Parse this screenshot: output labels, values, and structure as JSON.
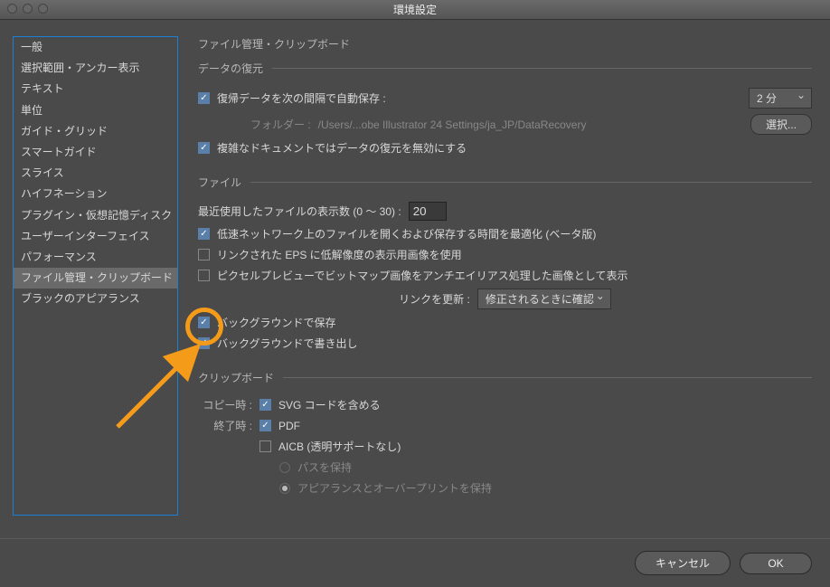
{
  "title": "環境設定",
  "sidebar": {
    "items": [
      "一般",
      "選択範囲・アンカー表示",
      "テキスト",
      "単位",
      "ガイド・グリッド",
      "スマートガイド",
      "スライス",
      "ハイフネーション",
      "プラグイン・仮想記憶ディスク",
      "ユーザーインターフェイス",
      "パフォーマンス",
      "ファイル管理・クリップボード",
      "ブラックのアピアランス"
    ],
    "selected_index": 11
  },
  "main": {
    "heading": "ファイル管理・クリップボード",
    "recovery": {
      "legend": "データの復元",
      "auto_save": {
        "checked": true,
        "label": "復帰データを次の間隔で自動保存 :"
      },
      "interval_value": "2 分",
      "folder_label": "フォルダー :",
      "folder_path": "/Users/...obe Illustrator 24 Settings/ja_JP/DataRecovery",
      "choose_button": "選択...",
      "disable_complex": {
        "checked": true,
        "label": "複雑なドキュメントではデータの復元を無効にする"
      }
    },
    "files": {
      "legend": "ファイル",
      "recent_label": "最近使用したファイルの表示数 (0 ～ 30)  :",
      "recent_value": "20",
      "slow_network": {
        "checked": true,
        "label": "低速ネットワーク上のファイルを開くおよび保存する時間を最適化 (ベータ版)"
      },
      "eps_lowres": {
        "checked": false,
        "label": "リンクされた EPS に低解像度の表示用画像を使用"
      },
      "pixel_preview": {
        "checked": false,
        "label": "ピクセルプレビューでビットマップ画像をアンチエイリアス処理した画像として表示"
      },
      "update_links_label": "リンクを更新 :",
      "update_links_value": "修正されるときに確認",
      "bg_save": {
        "checked": true,
        "label": "バックグラウンドで保存"
      },
      "bg_export": {
        "checked": true,
        "label": "バックグラウンドで書き出し"
      }
    },
    "clipboard": {
      "legend": "クリップボード",
      "copy_label": "コピー時 :",
      "quit_label": "終了時 :",
      "svg": {
        "checked": true,
        "label": "SVG コードを含める"
      },
      "pdf": {
        "checked": true,
        "label": "PDF"
      },
      "aicb": {
        "checked": false,
        "label": "AICB (透明サポートなし)"
      },
      "preserve_paths": {
        "selected": false,
        "label": "パスを保持"
      },
      "preserve_appearance": {
        "selected": true,
        "label": "アピアランスとオーバープリントを保持"
      }
    }
  },
  "buttons": {
    "cancel": "キャンセル",
    "ok": "OK"
  }
}
